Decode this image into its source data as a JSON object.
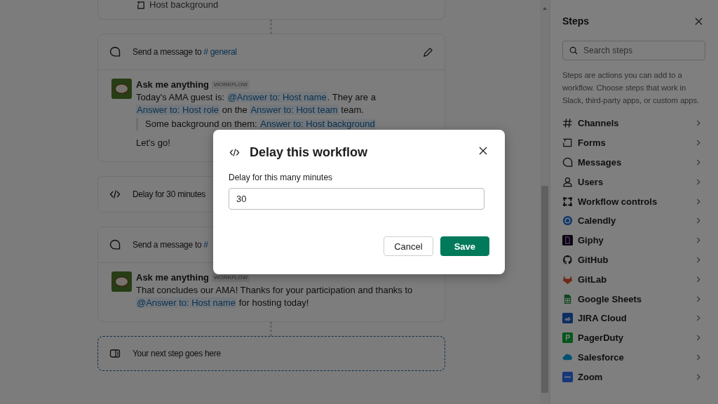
{
  "canvas": {
    "top_card": {
      "field_label": "Host background"
    },
    "steps": [
      {
        "kind": "message",
        "title": "Send a message to",
        "channel": "# general",
        "author": "Ask me anything",
        "badge": "WORKFLOW",
        "paragraphs": [
          [
            {
              "kind": "plain",
              "text": "Today's AMA guest is: "
            },
            {
              "kind": "token",
              "text": "@Answer to: Host name"
            },
            {
              "kind": "plain",
              "text": ". They are a "
            },
            {
              "kind": "token",
              "text": "Answer to: Host role"
            },
            {
              "kind": "plain",
              "text": " on the "
            },
            {
              "kind": "token",
              "text": "Answer to: Host team"
            },
            {
              "kind": "plain",
              "text": " team."
            }
          ]
        ],
        "quote": [
          {
            "kind": "plain",
            "text": "Some background on them: "
          },
          {
            "kind": "token",
            "text": "Answer to: Host background"
          }
        ],
        "closing": "Let's go!"
      },
      {
        "kind": "delay",
        "title": "Delay for 30 minutes"
      },
      {
        "kind": "message",
        "title": "Send a message to",
        "channel": "#",
        "author": "Ask me anything",
        "badge": "WORKFLOW",
        "paragraphs": [
          [
            {
              "kind": "plain",
              "text": "That concludes our AMA! Thanks for your participation and thanks to "
            },
            {
              "kind": "token",
              "text": "@Answer to: Host name"
            },
            {
              "kind": "plain",
              "text": " for hosting today!"
            }
          ]
        ]
      },
      {
        "kind": "placeholder",
        "title": "Your next step goes here"
      }
    ]
  },
  "steps_panel": {
    "title": "Steps",
    "search": {
      "placeholder": "Search steps"
    },
    "description": "Steps are actions you can add to a workflow. Choose steps that work in Slack, third-party apps, or custom apps.",
    "items": [
      {
        "label": "Channels"
      },
      {
        "label": "Forms"
      },
      {
        "label": "Messages"
      },
      {
        "label": "Users"
      },
      {
        "label": "Workflow controls"
      },
      {
        "label": "Calendly"
      },
      {
        "label": "Giphy"
      },
      {
        "label": "GitHub"
      },
      {
        "label": "GitLab"
      },
      {
        "label": "Google Sheets"
      },
      {
        "label": "JIRA Cloud"
      },
      {
        "label": "PagerDuty"
      },
      {
        "label": "Salesforce"
      },
      {
        "label": "Zoom"
      }
    ]
  },
  "dialog": {
    "title": "Delay this workflow",
    "field_label": "Delay for this many minutes",
    "value": "30",
    "buttons": [
      {
        "kind": "secondary",
        "label": "Cancel"
      },
      {
        "kind": "primary",
        "label": "Save"
      }
    ]
  }
}
